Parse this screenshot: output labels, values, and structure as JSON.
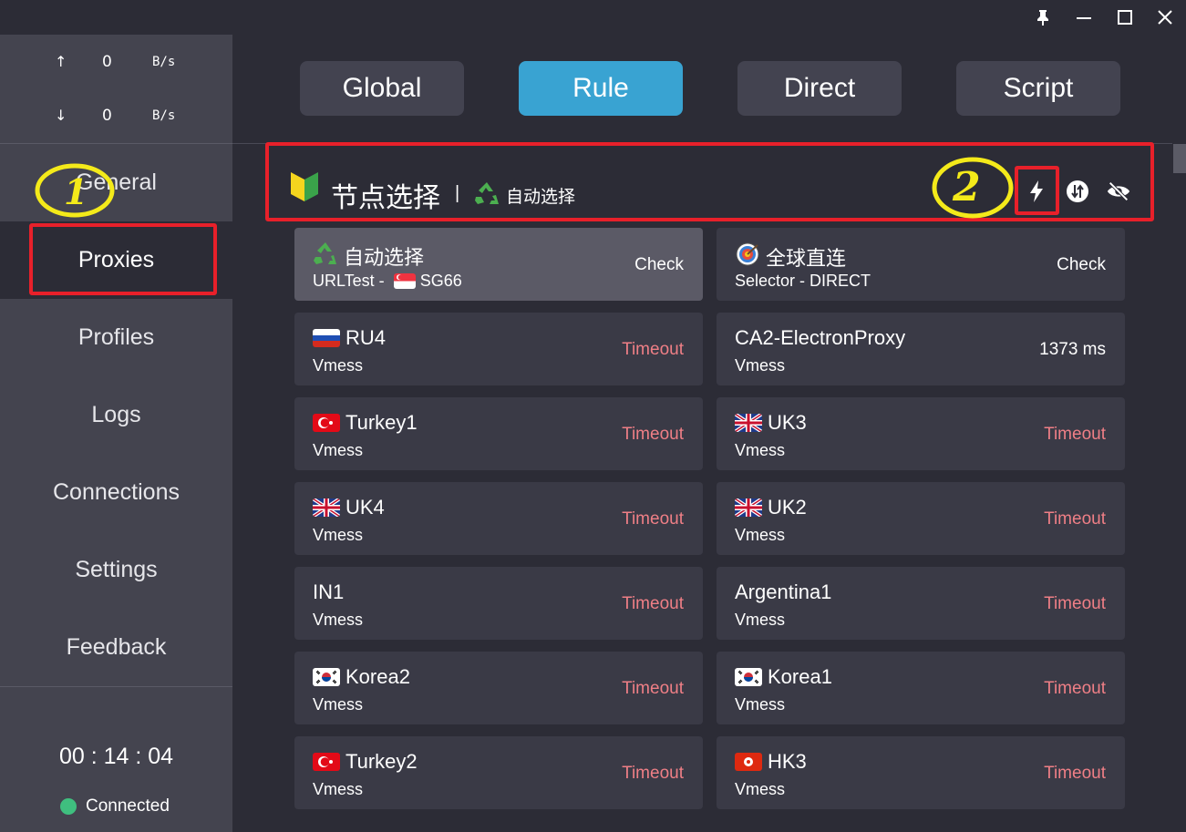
{
  "window": {
    "controls": [
      "pin-icon",
      "minimize-icon",
      "maximize-icon",
      "close-icon"
    ]
  },
  "traffic": {
    "up": {
      "arrow": "↑",
      "value": "0",
      "unit": "B/s"
    },
    "down": {
      "arrow": "↓",
      "value": "0",
      "unit": "B/s"
    }
  },
  "nav": {
    "items": [
      {
        "label": "General"
      },
      {
        "label": "Proxies"
      },
      {
        "label": "Profiles"
      },
      {
        "label": "Logs"
      },
      {
        "label": "Connections"
      },
      {
        "label": "Settings"
      },
      {
        "label": "Feedback"
      }
    ],
    "active": "Proxies"
  },
  "status": {
    "timer": "00 : 14 : 04",
    "connection": "Connected",
    "connection_color": "#3fbf7f"
  },
  "modes": {
    "tabs": [
      {
        "label": "Global"
      },
      {
        "label": "Rule"
      },
      {
        "label": "Direct"
      },
      {
        "label": "Script"
      }
    ],
    "active": "Rule",
    "accent": "#39a3d2"
  },
  "group": {
    "icon": "beginner-shield-icon",
    "title": "节点选择",
    "separator": "|",
    "selected_icon": "recycle-icon",
    "selected": "自动选择",
    "actions": [
      "lightning-icon",
      "sort-icon",
      "eye-off-icon"
    ]
  },
  "annotations": {
    "mark_1": "1",
    "mark_2": "2",
    "mark_color": "#f4ea1a",
    "box_color": "#e8202a"
  },
  "proxies": [
    {
      "name": "自动选择",
      "icon": "recycle-icon",
      "type": "URLTest - ",
      "type_flag": "sg",
      "type_suffix": "SG66",
      "delay": "Check",
      "selected": true
    },
    {
      "name": "全球直连",
      "icon": "target-icon",
      "type": "Selector - DIRECT",
      "delay": "Check"
    },
    {
      "name": "RU4",
      "flag": "ru",
      "type": "Vmess",
      "delay": "Timeout"
    },
    {
      "name": "CA2-ElectronProxy",
      "type": "Vmess",
      "delay": "1373 ms"
    },
    {
      "name": "Turkey1",
      "flag": "tr",
      "type": "Vmess",
      "delay": "Timeout"
    },
    {
      "name": "UK3",
      "flag": "gb",
      "type": "Vmess",
      "delay": "Timeout"
    },
    {
      "name": "UK4",
      "flag": "gb",
      "type": "Vmess",
      "delay": "Timeout"
    },
    {
      "name": "UK2",
      "flag": "gb",
      "type": "Vmess",
      "delay": "Timeout"
    },
    {
      "name": "IN1",
      "type": "Vmess",
      "delay": "Timeout"
    },
    {
      "name": "Argentina1",
      "type": "Vmess",
      "delay": "Timeout"
    },
    {
      "name": "Korea2",
      "flag": "kr",
      "type": "Vmess",
      "delay": "Timeout"
    },
    {
      "name": "Korea1",
      "flag": "kr",
      "type": "Vmess",
      "delay": "Timeout"
    },
    {
      "name": "Turkey2",
      "flag": "tr",
      "type": "Vmess",
      "delay": "Timeout"
    },
    {
      "name": "HK3",
      "flag": "hk",
      "type": "Vmess",
      "delay": "Timeout"
    }
  ]
}
